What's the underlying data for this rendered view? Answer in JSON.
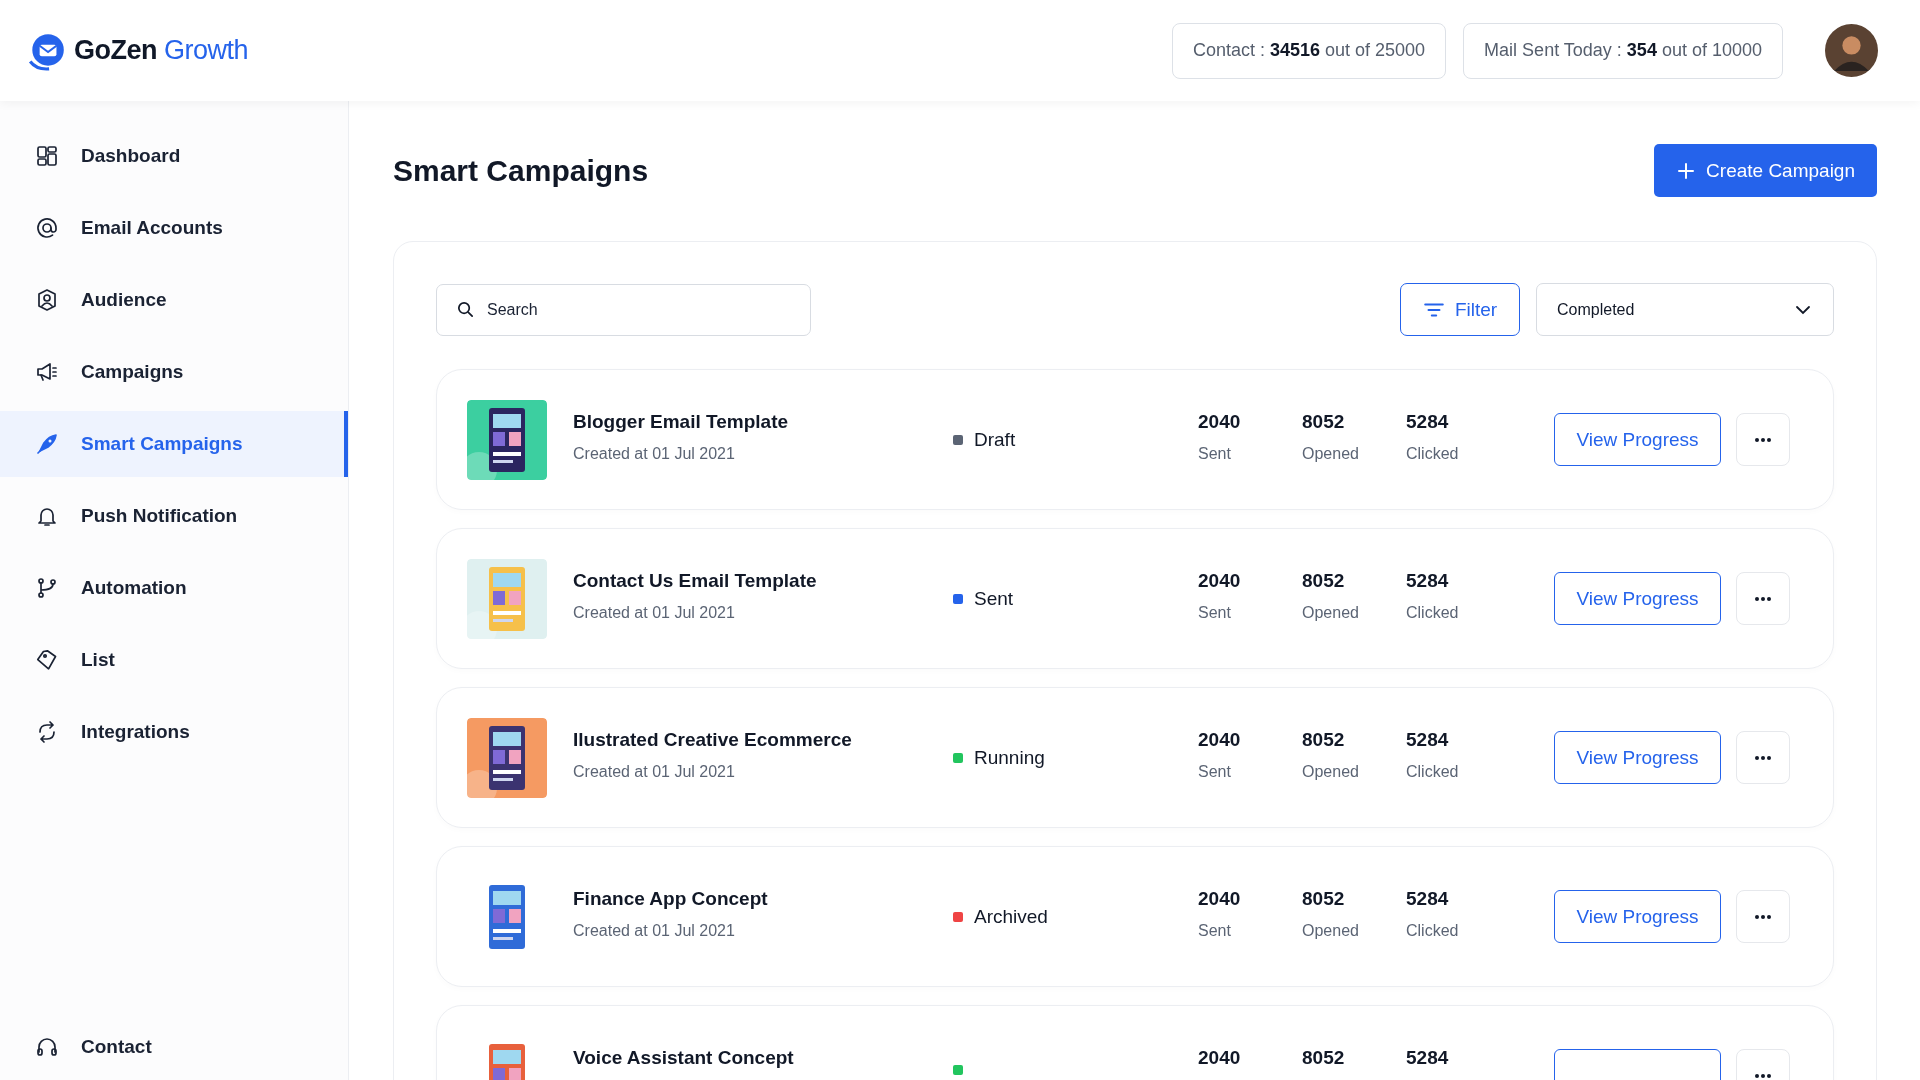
{
  "brand": {
    "name": "GoZen",
    "accent": "Growth"
  },
  "quotas": [
    {
      "label": "Contact : ",
      "value": "34516",
      "suffix": " out of 25000"
    },
    {
      "label": "Mail Sent Today : ",
      "value": "354",
      "suffix": " out of 10000"
    }
  ],
  "sidebar": {
    "items": [
      {
        "label": "Dashboard",
        "selected": false
      },
      {
        "label": "Email Accounts",
        "selected": false
      },
      {
        "label": "Audience",
        "selected": false
      },
      {
        "label": "Campaigns",
        "selected": false
      },
      {
        "label": "Smart Campaigns",
        "selected": true
      },
      {
        "label": "Push Notification",
        "selected": false
      },
      {
        "label": "Automation",
        "selected": false
      },
      {
        "label": "List",
        "selected": false
      },
      {
        "label": "Integrations",
        "selected": false
      }
    ],
    "footer": {
      "label": "Contact"
    }
  },
  "page": {
    "title": "Smart Campaigns",
    "create_button": "Create Campaign"
  },
  "toolbar": {
    "search": {
      "placeholder": "Search"
    },
    "filter": "Filter",
    "status_select": "Completed"
  },
  "campaigns": [
    {
      "title": "Blogger Email Template",
      "created": "Created at 01 Jul 2021",
      "status": "Draft",
      "color": "#5b6474",
      "sent": "2040",
      "sent_label": "Sent",
      "opened": "8052",
      "opened_label": "Opened",
      "clicked": "5284",
      "clicked_label": "Clicked",
      "action": "View Progress"
    },
    {
      "title": "Contact Us Email Template",
      "created": "Created at 01 Jul 2021",
      "status": "Sent",
      "color": "#2563eb",
      "sent": "2040",
      "sent_label": "Sent",
      "opened": "8052",
      "opened_label": "Opened",
      "clicked": "5284",
      "clicked_label": "Clicked",
      "action": "View Progress"
    },
    {
      "title": "Ilustrated Creative Ecommerce",
      "created": "Created at 01 Jul 2021",
      "status": "Running",
      "color": "#22c55e",
      "sent": "2040",
      "sent_label": "Sent",
      "opened": "8052",
      "opened_label": "Opened",
      "clicked": "5284",
      "clicked_label": "Clicked",
      "action": "View Progress"
    },
    {
      "title": "Finance App Concept",
      "created": "Created at 01 Jul 2021",
      "status": "Archived",
      "color": "#ef4444",
      "sent": "2040",
      "sent_label": "Sent",
      "opened": "8052",
      "opened_label": "Opened",
      "clicked": "5284",
      "clicked_label": "Clicked",
      "action": "View Progress"
    },
    {
      "title": "Voice Assistant Concept",
      "color": "#22c55e",
      "sent": "2040",
      "opened": "8052",
      "clicked": "5284"
    }
  ]
}
